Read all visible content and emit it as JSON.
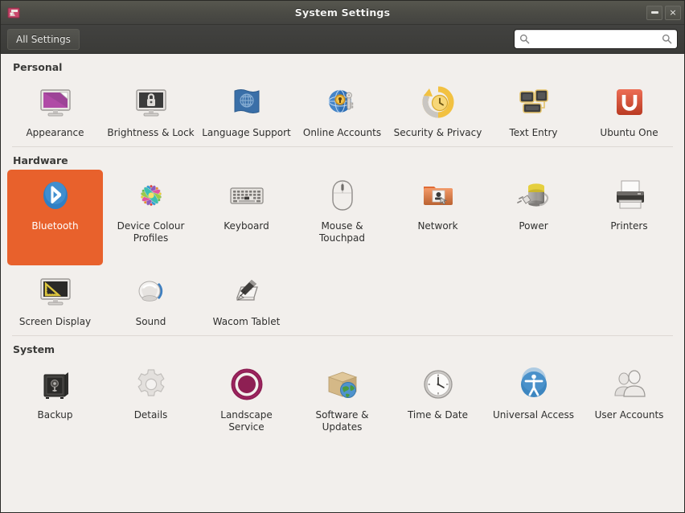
{
  "window": {
    "title": "System Settings",
    "app_icon": "system-settings-icon",
    "buttons": {
      "minimize": "minimize-button",
      "close": "×"
    }
  },
  "toolbar": {
    "all_settings_label": "All Settings",
    "search_placeholder": "",
    "search_value": "",
    "search_icon_left": "search-icon",
    "search_icon_right": "search-icon"
  },
  "colors": {
    "selection": "#e8612c",
    "content_bg": "#f2efec",
    "titlebar_bg": "#4b4b45",
    "toolbar_bg": "#3e3e3b",
    "selected_label": "#ffffff"
  },
  "sections": [
    {
      "title": "Personal",
      "items": [
        {
          "label": "Appearance",
          "icon": "appearance-icon"
        },
        {
          "label": "Brightness & Lock",
          "icon": "brightness-lock-icon"
        },
        {
          "label": "Language Support",
          "icon": "language-support-icon"
        },
        {
          "label": "Online Accounts",
          "icon": "online-accounts-icon"
        },
        {
          "label": "Security & Privacy",
          "icon": "security-privacy-icon"
        },
        {
          "label": "Text Entry",
          "icon": "text-entry-icon"
        },
        {
          "label": "Ubuntu One",
          "icon": "ubuntu-one-icon"
        }
      ]
    },
    {
      "title": "Hardware",
      "items": [
        {
          "label": "Bluetooth",
          "icon": "bluetooth-icon",
          "selected": true
        },
        {
          "label": "Device Colour Profiles",
          "icon": "device-colour-profiles-icon"
        },
        {
          "label": "Keyboard",
          "icon": "keyboard-icon"
        },
        {
          "label": "Mouse & Touchpad",
          "icon": "mouse-touchpad-icon"
        },
        {
          "label": "Network",
          "icon": "network-icon"
        },
        {
          "label": "Power",
          "icon": "power-icon"
        },
        {
          "label": "Printers",
          "icon": "printers-icon"
        },
        {
          "label": "Screen Display",
          "icon": "screen-display-icon"
        },
        {
          "label": "Sound",
          "icon": "sound-icon"
        },
        {
          "label": "Wacom Tablet",
          "icon": "wacom-tablet-icon"
        }
      ]
    },
    {
      "title": "System",
      "items": [
        {
          "label": "Backup",
          "icon": "backup-icon"
        },
        {
          "label": "Details",
          "icon": "details-icon"
        },
        {
          "label": "Landscape Service",
          "icon": "landscape-service-icon"
        },
        {
          "label": "Software & Updates",
          "icon": "software-updates-icon"
        },
        {
          "label": "Time & Date",
          "icon": "time-date-icon"
        },
        {
          "label": "Universal Access",
          "icon": "universal-access-icon"
        },
        {
          "label": "User Accounts",
          "icon": "user-accounts-icon"
        }
      ]
    }
  ]
}
